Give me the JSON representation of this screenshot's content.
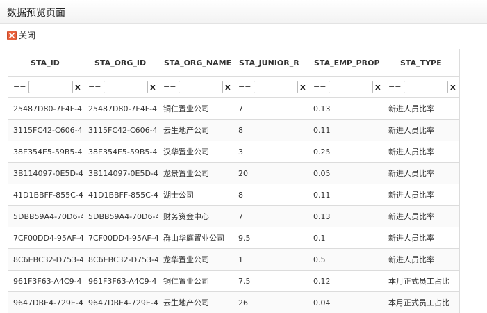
{
  "window": {
    "title": "数据预览页面"
  },
  "toolbar": {
    "close_label": "关闭"
  },
  "filter": {
    "operator": "==",
    "clear": "x",
    "value": ""
  },
  "table": {
    "columns": [
      "STA_ID",
      "STA_ORG_ID",
      "STA_ORG_NAME",
      "STA_JUNIOR_R",
      "STA_EMP_PROP",
      "STA_TYPE"
    ],
    "rows": [
      [
        "25487D80-7F4F-4",
        "25487D80-7F4F-4",
        "铜仁置业公司",
        "7",
        "0.13",
        "新进人员比率"
      ],
      [
        "3115FC42-C606-4",
        "3115FC42-C606-4",
        "云生地产公司",
        "8",
        "0.11",
        "新进人员比率"
      ],
      [
        "38E354E5-59B5-4",
        "38E354E5-59B5-4",
        "汉华置业公司",
        "3",
        "0.25",
        "新进人员比率"
      ],
      [
        "3B114097-0E5D-4",
        "3B114097-0E5D-4",
        "龙景置业公司",
        "20",
        "0.05",
        "新进人员比率"
      ],
      [
        "41D1BBFF-855C-4",
        "41D1BBFF-855C-4",
        "湖士公司",
        "8",
        "0.11",
        "新进人员比率"
      ],
      [
        "5DBB59A4-70D6-4",
        "5DBB59A4-70D6-4",
        "财务资金中心",
        "7",
        "0.13",
        "新进人员比率"
      ],
      [
        "7CF00DD4-95AF-4",
        "7CF00DD4-95AF-4",
        "群山华庭置业公司",
        "9.5",
        "0.1",
        "新进人员比率"
      ],
      [
        "8C6EBC32-D753-4",
        "8C6EBC32-D753-4",
        "龙华置业公司",
        "1",
        "0.5",
        "新进人员比率"
      ],
      [
        "961F3F63-A4C9-4",
        "961F3F63-A4C9-4",
        "铜仁置业公司",
        "7.5",
        "0.12",
        "本月正式员工占比"
      ],
      [
        "9647DBE4-729E-4",
        "9647DBE4-729E-4",
        "云生地产公司",
        "26",
        "0.04",
        "本月正式员工占比"
      ]
    ]
  },
  "colors": {
    "close_icon": "#e8603c",
    "border": "#dcdcdc"
  }
}
